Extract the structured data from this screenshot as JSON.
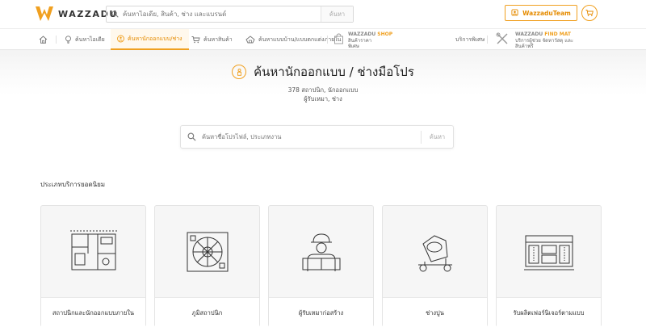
{
  "header": {
    "brand": "WAZZADU",
    "search_placeholder": "ค้นหาไอเดีย, สินค้า, ช่าง และแบรนด์",
    "search_button": "ค้นหา",
    "team_button": "WazzaduTeam"
  },
  "nav": {
    "items": [
      {
        "label": "ค้นหาไอเดีย"
      },
      {
        "label": "ค้นหานักออกแบบ/ช่าง"
      },
      {
        "label": "ค้นหาสินค้า"
      },
      {
        "label": "ค้นหาแบบบ้าน/แบบตกแต่งภายใน"
      }
    ],
    "shop": {
      "brand": "WAZZADU",
      "brand_suffix": "SHOP",
      "line1": "สินค้าราคา",
      "line2": "พิเศษ"
    },
    "service": {
      "label": "บริการพิเศษ"
    },
    "findmat": {
      "brand": "WAZZADU",
      "brand_suffix": "FIND MAT",
      "line1": "บริการผู้ช่วย จัดหาวัสดุ และ",
      "line2": "สินค้าฟรี"
    }
  },
  "hero": {
    "title": "ค้นหานักออกแบบ / ช่างมือโปร",
    "sub1": "378 สถาปนิก, นักออกแบบ",
    "sub2": "ผู้รับเหมา, ช่าง",
    "search_placeholder": "ค้นหาชื่อโปรไฟล์, ประเภทงาน",
    "search_button": "ค้นหา"
  },
  "section": {
    "title": "ประเภทบริการยอดนิยม",
    "cards": [
      {
        "label": "สถาปนิกและนักออกแบบภายใน",
        "icon": "floorplan-icon"
      },
      {
        "label": "ภูมิสถาปนิก",
        "icon": "landscape-icon"
      },
      {
        "label": "ผู้รับเหมาก่อสร้าง",
        "icon": "contractor-icon"
      },
      {
        "label": "ช่างปูน",
        "icon": "cement-mixer-icon"
      },
      {
        "label": "รับผลิตเฟอร์นิเจอร์ตามแบบ",
        "icon": "furniture-icon"
      }
    ]
  },
  "colors": {
    "accent": "#f0a020",
    "accent_dark": "#e58b00"
  }
}
